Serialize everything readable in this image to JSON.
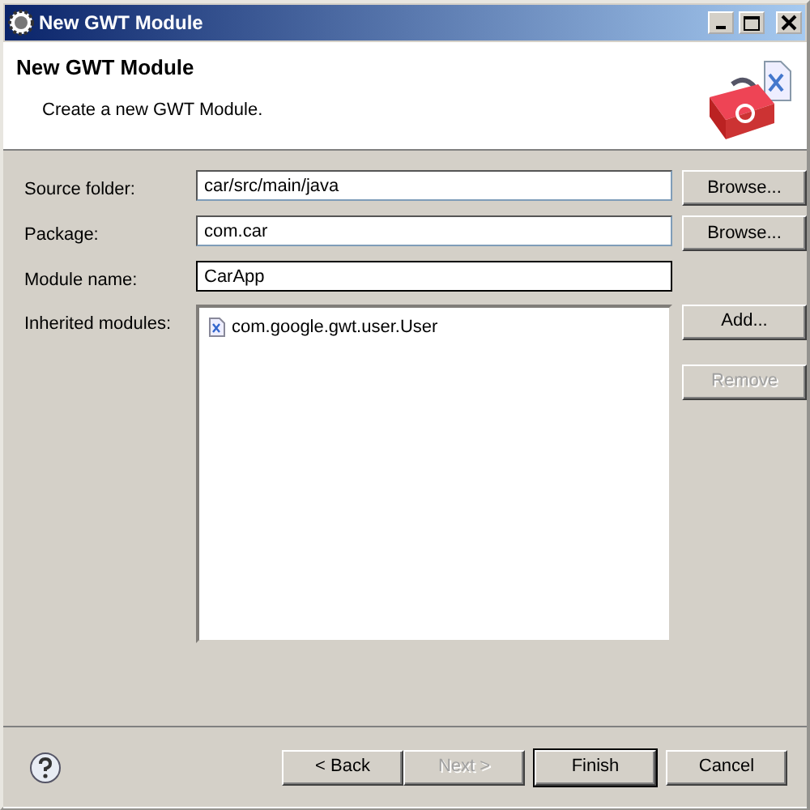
{
  "window": {
    "title": "New GWT Module"
  },
  "header": {
    "title": "New GWT Module",
    "description": "Create a new GWT Module."
  },
  "fields": [
    {
      "kind": "text",
      "label": "Source folder:",
      "value": "car/src/main/java",
      "button": {
        "label": "Browse...",
        "disabled": false
      }
    },
    {
      "kind": "text",
      "label": "Package:",
      "value": "com.car",
      "button": {
        "label": "Browse...",
        "disabled": false
      }
    },
    {
      "kind": "text",
      "label": "Module name:",
      "value": "CarApp",
      "focused": true
    },
    {
      "kind": "list",
      "label": "Inherited modules:",
      "items": [
        "com.google.gwt.user.User"
      ],
      "buttons": [
        {
          "label": "Add...",
          "disabled": false
        },
        {
          "label": "Remove",
          "disabled": true
        }
      ]
    }
  ],
  "footer_buttons": [
    {
      "label": "< Back",
      "disabled": false,
      "default": false
    },
    {
      "label": "Next >",
      "disabled": true,
      "default": false
    },
    {
      "label": "Finish",
      "disabled": false,
      "default": true
    },
    {
      "label": "Cancel",
      "disabled": false,
      "default": false
    }
  ]
}
